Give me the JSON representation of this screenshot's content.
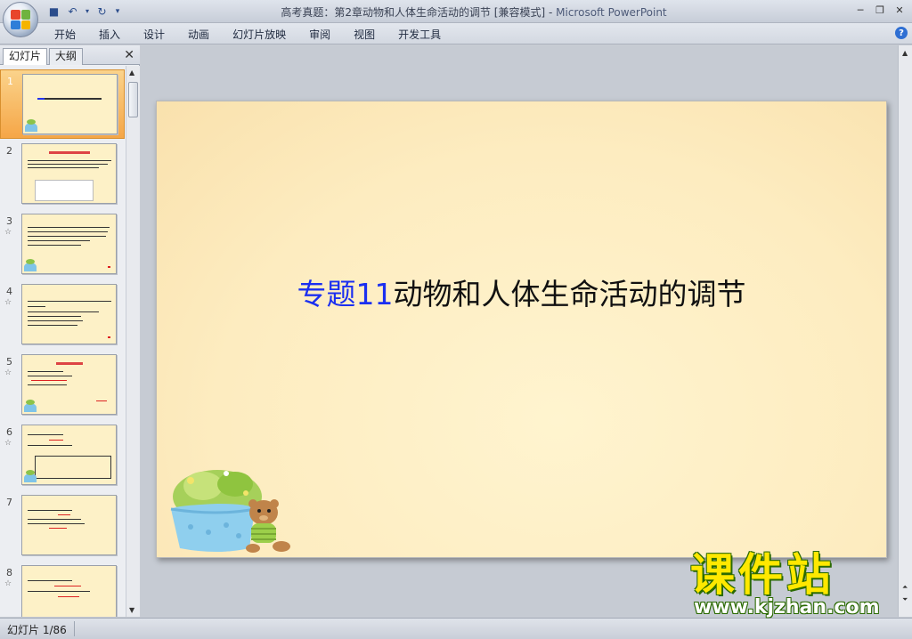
{
  "window": {
    "title": "高考真题：第2章动物和人体生命活动的调节 [兼容模式]",
    "app_name": "Microsoft PowerPoint",
    "title_sep": " - "
  },
  "ribbon": {
    "tabs": [
      "开始",
      "插入",
      "设计",
      "动画",
      "幻灯片放映",
      "审阅",
      "视图",
      "开发工具"
    ]
  },
  "left_pane": {
    "tabs": [
      "幻灯片",
      "大纲"
    ],
    "slides": [
      {
        "num": "1",
        "star": ""
      },
      {
        "num": "2",
        "star": ""
      },
      {
        "num": "3",
        "star": "☆"
      },
      {
        "num": "4",
        "star": "☆"
      },
      {
        "num": "5",
        "star": "☆"
      },
      {
        "num": "6",
        "star": "☆"
      },
      {
        "num": "7",
        "star": ""
      },
      {
        "num": "8",
        "star": "☆"
      }
    ]
  },
  "slide": {
    "title_blue": "专题11",
    "title_black": "动物和人体生命活动的调节"
  },
  "status": {
    "slide_counter": "幻灯片 1/86"
  },
  "watermark": {
    "big": "课件站",
    "small": "www.kjzhan.com"
  }
}
